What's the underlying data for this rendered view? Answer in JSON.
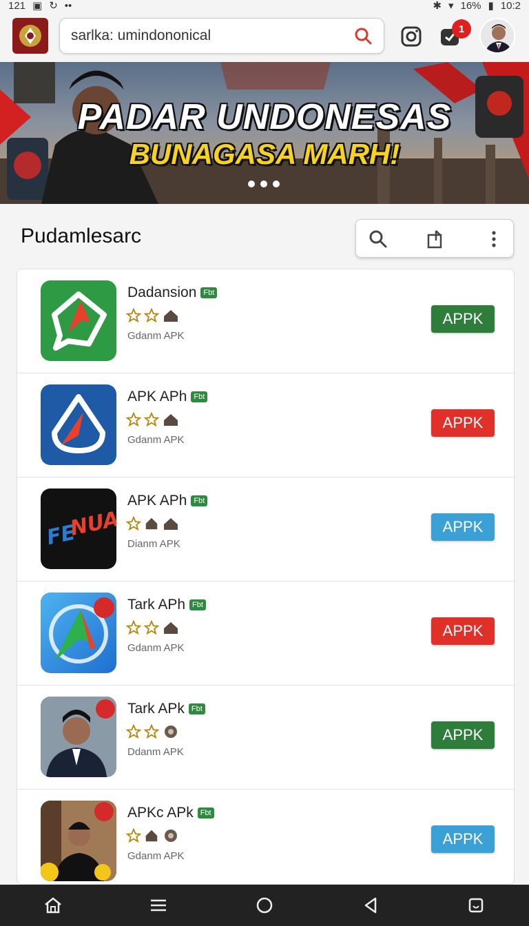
{
  "status": {
    "time": "121",
    "battery": "16%",
    "clock_right": "10:2"
  },
  "search": {
    "value": "sarlka: umindononical"
  },
  "notifications": {
    "count": "1"
  },
  "banner": {
    "title": "PADAR UNDONESAS",
    "subtitle": "BUNAGASA MARH!"
  },
  "section": {
    "title": "Pudamlesarc"
  },
  "apps": [
    {
      "name": "Dadansion",
      "tag": "Fbt",
      "sub": "Gdanm APK",
      "button": "APPK",
      "btn_color": "#2e7d3a",
      "icon_bg": "#2e9a43"
    },
    {
      "name": "APK APh",
      "tag": "Fbt",
      "sub": "Gdanm APK",
      "button": "APPK",
      "btn_color": "#e0302a",
      "icon_bg": "#1f5aa6"
    },
    {
      "name": "APK APh",
      "tag": "Fbt",
      "sub": "Dianm APK",
      "button": "APPK",
      "btn_color": "#3aa0d6",
      "icon_bg": "#111111"
    },
    {
      "name": "Tark APh",
      "tag": "Fbt",
      "sub": "Gdanm APK",
      "button": "APPK",
      "btn_color": "#e0302a",
      "icon_bg": "#2f8fe0"
    },
    {
      "name": "Tark APk",
      "tag": "Fbt",
      "sub": "Ddanm APK",
      "button": "APPK",
      "btn_color": "#2e7d3a",
      "icon_bg": "#6b7d8c"
    },
    {
      "name": "APKc APk",
      "tag": "Fbt",
      "sub": "Gdanm APK",
      "button": "APPK",
      "btn_color": "#3aa0d6",
      "icon_bg": "#7a5a40"
    }
  ]
}
